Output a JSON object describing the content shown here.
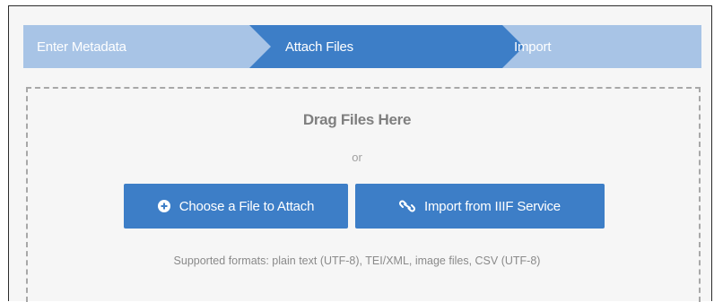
{
  "steps": {
    "items": [
      {
        "label": "Enter Metadata"
      },
      {
        "label": "Attach Files"
      },
      {
        "label": "Import"
      }
    ],
    "active_index": 1
  },
  "dropzone": {
    "heading": "Drag Files Here",
    "separator": "or",
    "buttons": {
      "choose_label": "Choose a File to Attach",
      "choose_icon": "plus-circle-icon",
      "iiif_label": "Import from IIIF Service",
      "iiif_icon": "link-icon"
    },
    "supported_formats": "Supported formats: plain text (UTF-8), TEI/XML, image files, CSV (UTF-8)"
  },
  "colors": {
    "step_bar": "#a8c4e6",
    "step_active": "#3d7ec7",
    "button": "#3d7ec7",
    "dropzone_border": "#a8a8a8",
    "background": "#f6f6f6"
  }
}
